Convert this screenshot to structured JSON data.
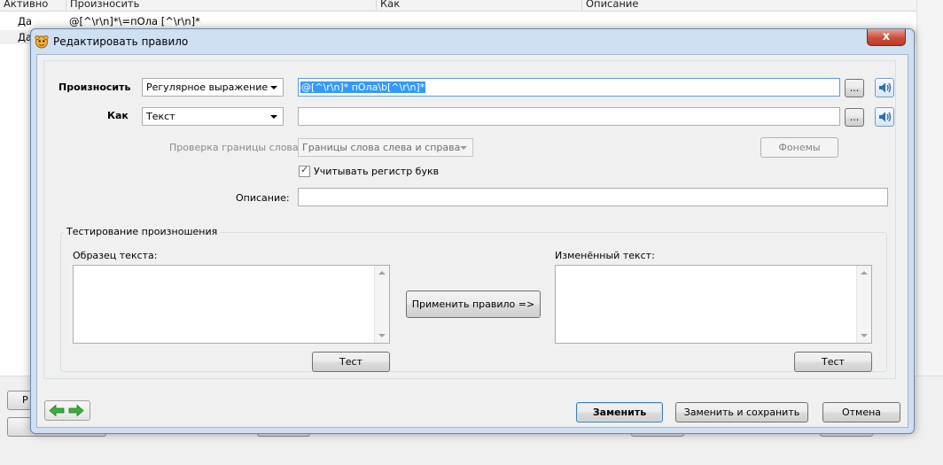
{
  "background_list": {
    "columns": [
      "Активно",
      "Произносить",
      "Как",
      "Описание"
    ],
    "rows": [
      {
        "active": "Да",
        "pronounce": "@[^\\r\\n]*\\=пОла [^\\r\\n]*",
        "as": "",
        "description": ""
      },
      {
        "active": "Да",
        "pronounce": "",
        "as": "",
        "description": ""
      }
    ],
    "bottom_button_label": "Р"
  },
  "dialog": {
    "title": "Редактировать правило",
    "close_label": "x",
    "pronounce": {
      "label": "Произносить",
      "type_value": "Регулярное выражение",
      "value": "@[^\\r\\n]* пОла\\b[^\\r\\n]*",
      "browse_label": "..."
    },
    "as": {
      "label": "Как",
      "type_value": "Текст",
      "value": "",
      "browse_label": "..."
    },
    "word_boundary": {
      "label": "Проверка границы слова",
      "value": "Границы слова слева и справа"
    },
    "phonemes_label": "Фонемы",
    "case_sensitive_label": "Учитывать регистр букв",
    "case_sensitive_checked": true,
    "description": {
      "label": "Описание:",
      "value": ""
    },
    "testing": {
      "group_title": "Тестирование произношения",
      "sample_label": "Образец текста:",
      "sample_value": "",
      "changed_label": "Изменённый текст:",
      "changed_value": "",
      "apply_label": "Применить правило =>",
      "test_label_left": "Тест",
      "test_label_right": "Тест"
    },
    "buttons": {
      "replace": "Заменить",
      "replace_save": "Заменить и сохранить",
      "cancel": "Отмена"
    },
    "colors": {
      "selection": "#3399ff",
      "title_bar": "#cfe0f3",
      "close": "#c9503b",
      "nav_arrows": "#3cae3c"
    }
  }
}
